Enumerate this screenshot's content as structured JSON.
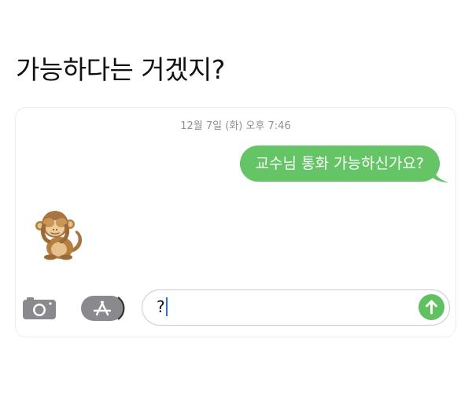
{
  "post": {
    "caption": "가능하다는 거겠지?"
  },
  "conversation": {
    "timestamp": "12월 7일 (화) 오후 7:46",
    "messages": [
      {
        "direction": "outgoing",
        "text": "교수님 통화 가능하신가요?"
      }
    ],
    "incoming_reaction": {
      "type": "emoji",
      "icon": "see-no-evil-monkey-icon"
    }
  },
  "composer": {
    "camera_icon": "camera-icon",
    "apps_icon": "app-store-icon",
    "input_value": "?",
    "send_icon": "send-arrow-up-icon"
  },
  "colors": {
    "bubble_green": "#65c466",
    "send_green": "#5fc15f",
    "timestamp_gray": "#8e8e93",
    "icon_gray": "#8a8a8e"
  }
}
